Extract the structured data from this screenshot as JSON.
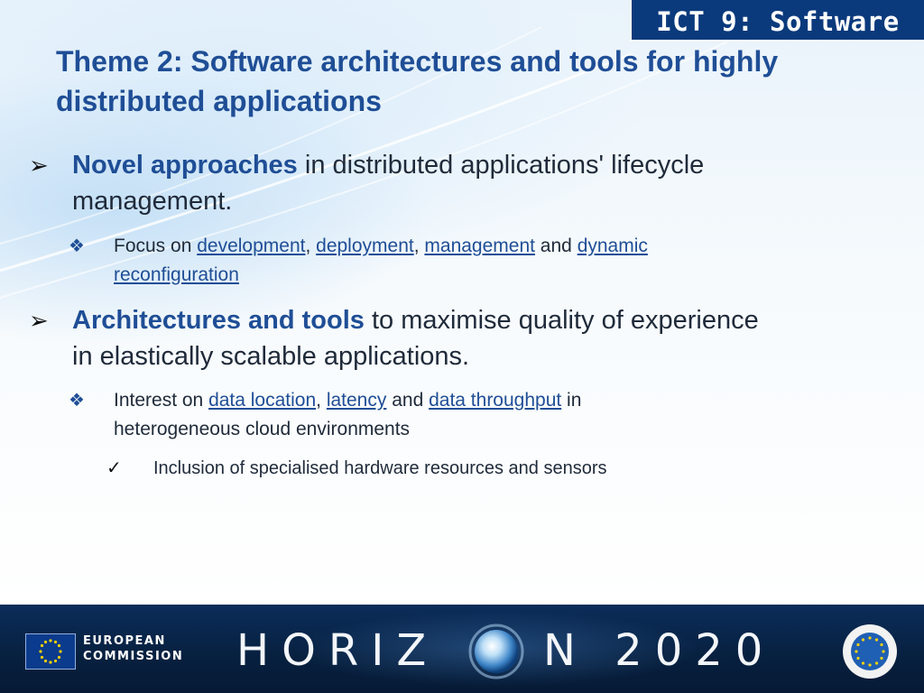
{
  "tag": "ICT 9: Software",
  "title": "Theme 2: Software architectures and tools for highly distributed applications",
  "bullet1": {
    "bold": "Novel approaches",
    "rest_line1": " in distributed applications' lifecycle",
    "rest_line2": "management.",
    "sub": {
      "prefix": "Focus on ",
      "t1": "development",
      "sep1": ", ",
      "t2": "deployment",
      "sep2": ", ",
      "t3": "management",
      "sep3": " and ",
      "t4a": "dynamic",
      "t4b": "reconfiguration"
    }
  },
  "bullet2": {
    "bold": "Architectures and tools",
    "rest_line1": " to maximise quality of experience",
    "rest_line2": "in elastically scalable applications.",
    "sub": {
      "prefix": "Interest on ",
      "t1": "data location",
      "sep1": ", ",
      "t2": "latency",
      "sep2": " and ",
      "t3": "data throughput",
      "suffix_line1": " in",
      "line2": "heterogeneous cloud environments"
    },
    "subsub": "Inclusion of specialised hardware resources and sensors"
  },
  "footer": {
    "org_line1": "EUROPEAN",
    "org_line2": "COMMISSION",
    "program_left": "HORIZ",
    "program_right": "N 2020"
  },
  "markers": {
    "level1": "➢",
    "level2": "❖",
    "level3": "✓"
  },
  "colors": {
    "title": "#1f4e96",
    "tag_bg": "#0a3a7c",
    "footer_bg": "#07203f"
  },
  "icons": [
    "eu-flag-icon",
    "globe-icon",
    "innovation-union-seal-icon"
  ]
}
